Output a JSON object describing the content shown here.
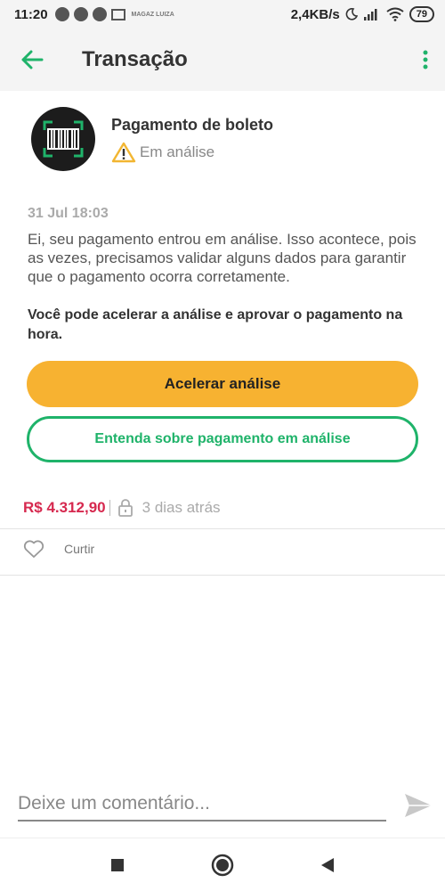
{
  "status_bar": {
    "time": "11:20",
    "network_speed": "2,4KB/s",
    "battery": "79",
    "mini_label": "MAGAZ LUIZA"
  },
  "app_bar": {
    "title": "Transação"
  },
  "transaction": {
    "title": "Pagamento de boleto",
    "status": "Em análise",
    "date": "31 Jul 18:03",
    "message": "Ei, seu pagamento entrou em análise. Isso acontece, pois as vezes, precisamos validar alguns dados para garantir que o pagamento ocorra corretamente.",
    "highlight": "Você pode acelerar a análise e aprovar o pagamento na hora.",
    "amount": "R$ 4.312,90",
    "time_ago": "3 dias atrás"
  },
  "actions": {
    "primary_label": "Acelerar análise",
    "secondary_label": "Entenda sobre pagamento em análise"
  },
  "social": {
    "like_label": "Curtir"
  },
  "comment": {
    "placeholder": "Deixe um comentário..."
  },
  "colors": {
    "brand_green": "#1fb36a",
    "accent_yellow": "#f7b231",
    "amount_red": "#d6294f",
    "warning_yellow": "#f2b632"
  },
  "icons": {
    "back": "arrow-left-icon",
    "menu": "more-vertical-icon",
    "avatar": "barcode-icon",
    "status": "warning-triangle-icon",
    "privacy": "lock-icon",
    "like": "heart-icon",
    "send": "send-icon"
  }
}
